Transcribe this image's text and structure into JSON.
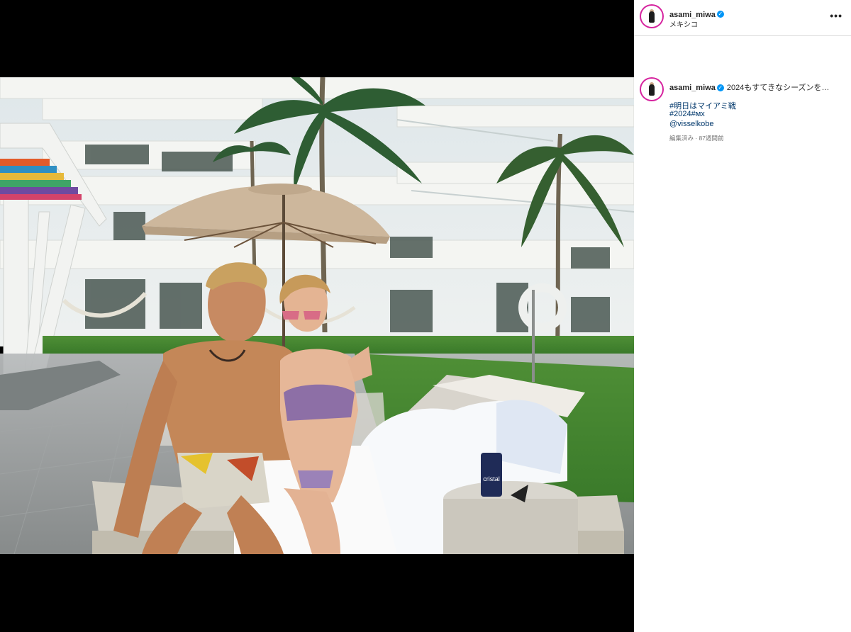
{
  "post": {
    "username": "asami_miwa",
    "location": "メキシコ",
    "more_label": "•••",
    "caption": "2024もすてきなシーズンを…",
    "hashtags": [
      "#明日はマイアミ戦",
      "#2024#ᴍx"
    ],
    "mention": "@visselkobe",
    "meta": "編集済み · 87週間前",
    "image_can_text": "cristal"
  },
  "colors": {
    "verified": "#0095f6",
    "link": "#00376b",
    "meta": "#737373"
  }
}
